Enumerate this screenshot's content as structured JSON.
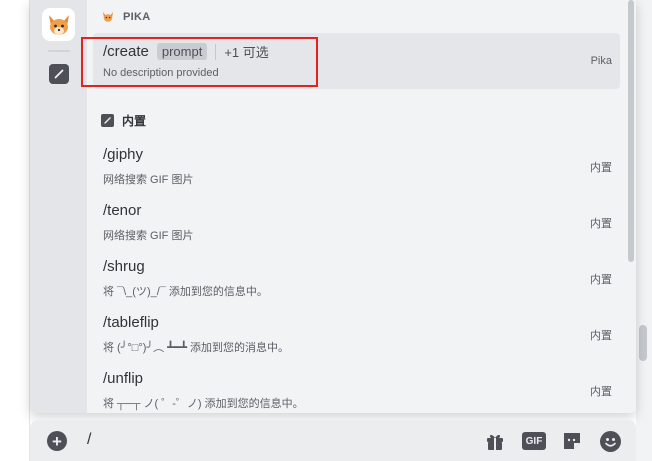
{
  "app": {
    "name": "PIKA",
    "source_label": "Pika"
  },
  "sections": {
    "app_header": "PIKA",
    "builtin_header": "内置"
  },
  "commands_app": [
    {
      "name": "/create",
      "option": "prompt",
      "more_options": "+1 可选",
      "description": "No description provided",
      "source": "Pika"
    }
  ],
  "commands_builtin": [
    {
      "name": "/giphy",
      "description": "网络搜索 GIF 图片",
      "source": "内置"
    },
    {
      "name": "/tenor",
      "description": "网络搜索 GIF 图片",
      "source": "内置"
    },
    {
      "name": "/shrug",
      "description": "将 ¯\\_(ツ)_/¯ 添加到您的信息中。",
      "source": "内置"
    },
    {
      "name": "/tableflip",
      "description": "将 (╯°□°)╯︵ ┻━┻ 添加到您的消息中。",
      "source": "内置"
    },
    {
      "name": "/unflip",
      "description": "将 ┬─┬ ノ( ゜-゜ノ) 添加到您的信息中。",
      "source": "内置"
    }
  ],
  "composer": {
    "value": "/",
    "gif_label": "GIF"
  },
  "icons": {
    "app_avatar": "fox-avatar-icon",
    "builtin": "slash-command-icon",
    "upload": "plus-circle-icon",
    "gift": "gift-icon",
    "gif": "gif-icon",
    "sticker": "sticker-icon",
    "emoji": "emoji-icon"
  },
  "colors": {
    "highlight": "#e02424",
    "selected_row": "#e4e6e9",
    "panel": "#f2f3f5"
  }
}
